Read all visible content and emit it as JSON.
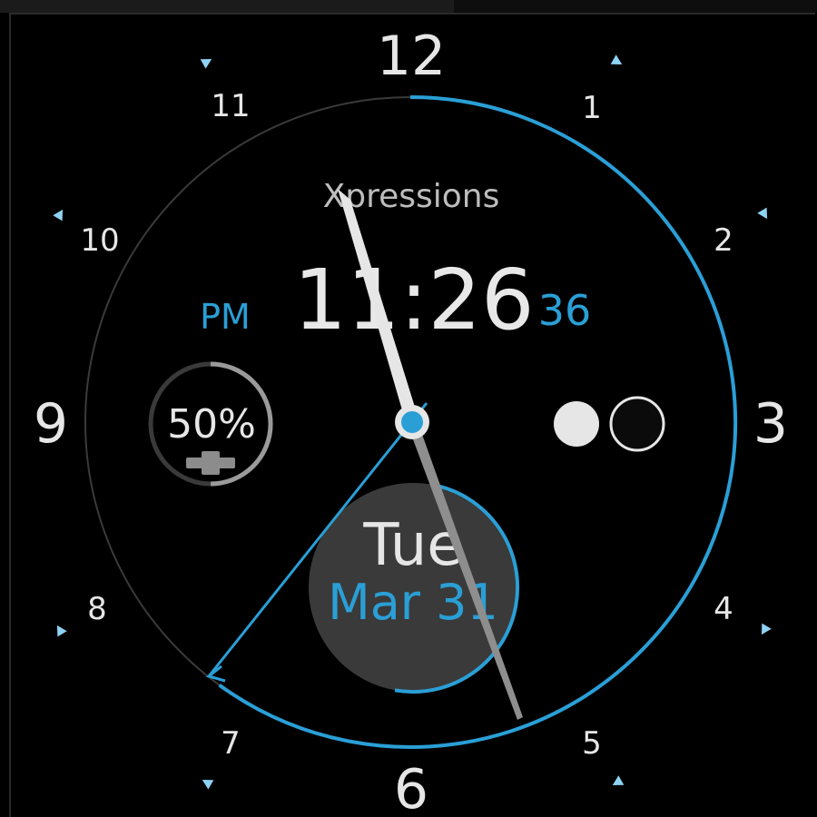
{
  "dial": {
    "numbers": [
      "12",
      "1",
      "2",
      "3",
      "4",
      "5",
      "6",
      "7",
      "8",
      "9",
      "10",
      "11"
    ]
  },
  "face": {
    "brand": "Xpressions",
    "ampm": "PM",
    "time": "11:26",
    "seconds": "36",
    "battery_text": "50%",
    "battery_level": 0.5,
    "day": "Tue",
    "date": "Mar 31"
  },
  "colors": {
    "accent": "#2a9fd6",
    "text": "#e6e6e6",
    "date_bg": "#3a3a3a",
    "background": "#000000"
  },
  "icons": {
    "battery": "battery-icon",
    "moon_phase": "moon-phase-icon"
  }
}
